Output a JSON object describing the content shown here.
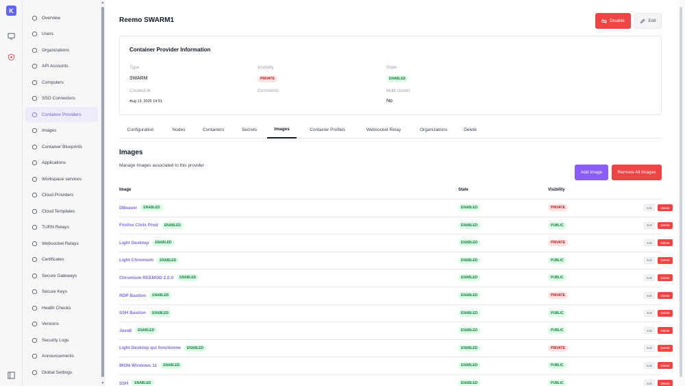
{
  "rail": {
    "logo": "K"
  },
  "sidebar": {
    "items": [
      {
        "label": "Overview",
        "icon": "home-icon"
      },
      {
        "label": "Users",
        "icon": "user-icon"
      },
      {
        "label": "Organizations",
        "icon": "building-icon"
      },
      {
        "label": "API Accounts",
        "icon": "api-icon"
      },
      {
        "label": "Computers",
        "icon": "computer-icon"
      },
      {
        "label": "SSO Connectors",
        "icon": "users-icon"
      },
      {
        "label": "Container Providers",
        "icon": "server-icon",
        "active": true
      },
      {
        "label": "Images",
        "icon": "layers-icon"
      },
      {
        "label": "Container Blueprints",
        "icon": "blueprint-icon"
      },
      {
        "label": "Applications",
        "icon": "puzzle-icon"
      },
      {
        "label": "Workspace services",
        "icon": "gear-icon"
      },
      {
        "label": "Cloud Providers",
        "icon": "cloud-icon"
      },
      {
        "label": "Cloud Templates",
        "icon": "template-icon"
      },
      {
        "label": "TURN Relays",
        "icon": "relay-icon"
      },
      {
        "label": "Websocket Relays",
        "icon": "code-icon"
      },
      {
        "label": "Certificates",
        "icon": "certificate-icon"
      },
      {
        "label": "Secure Gateways",
        "icon": "globe-icon"
      },
      {
        "label": "Secure Keys",
        "icon": "key-icon"
      },
      {
        "label": "Health Checks",
        "icon": "heart-icon"
      },
      {
        "label": "Versions",
        "icon": "info-icon"
      },
      {
        "label": "Security Logs",
        "icon": "shield-icon"
      },
      {
        "label": "Announcements",
        "icon": "bell-icon"
      },
      {
        "label": "Global Settings",
        "icon": "settings-icon"
      }
    ]
  },
  "header": {
    "title": "Reemo SWARM1",
    "disable_label": "Disable",
    "edit_label": "Edit"
  },
  "info": {
    "title": "Container Provider Information",
    "type_label": "Type",
    "type_value": "SWARM",
    "visibility_label": "Visibility",
    "visibility_value": "PRIVATE",
    "state_label": "State",
    "state_value": "ENABLED",
    "created_label": "Created At",
    "created_value": "Aug 13, 2025 14:51",
    "comments_label": "Comments",
    "multi_label": "Multi cluster",
    "multi_value": "No"
  },
  "tabs": [
    "Configuration",
    "Nodes",
    "Containers",
    "Secrets",
    "Images",
    "Container Profiles",
    "Websocket Relay",
    "Organizations",
    "Delete"
  ],
  "images_section": {
    "title": "Images",
    "description": "Manage Images associated to this provider",
    "add_label": "Add Image",
    "remove_label": "Remove All Images",
    "columns": [
      "Image",
      "State",
      "Visibility"
    ],
    "edit_label": "Edit",
    "delete_label": "Delete",
    "rows": [
      {
        "name": "DBeaver",
        "badge": "ENABLED",
        "state": "ENABLED",
        "visibility": "PRIVATE"
      },
      {
        "name": "Firefox Citrix Prod",
        "badge": "ENABLED",
        "state": "ENABLED",
        "visibility": "PUBLIC"
      },
      {
        "name": "Light Desktop",
        "badge": "ENABLED",
        "state": "ENABLED",
        "visibility": "PRIVATE"
      },
      {
        "name": "Light Chromium",
        "badge": "ENABLED",
        "state": "ENABLED",
        "visibility": "PUBLIC"
      },
      {
        "name": "Chromium REEMOD 2.0.0",
        "badge": "ENABLED",
        "state": "ENABLED",
        "visibility": "PUBLIC"
      },
      {
        "name": "RDP Bastion",
        "badge": "ENABLED",
        "state": "ENABLED",
        "visibility": "PRIVATE"
      },
      {
        "name": "SSH Bastion",
        "badge": "ENABLED",
        "state": "ENABLED",
        "visibility": "PUBLIC"
      },
      {
        "name": "Java8",
        "badge": "ENABLED",
        "state": "ENABLED",
        "visibility": "PUBLIC"
      },
      {
        "name": "Light Desktop qui fonctionne",
        "badge": "ENABLED",
        "state": "ENABLED",
        "visibility": "PRIVATE"
      },
      {
        "name": "IRON Windows 11",
        "badge": "ENABLED",
        "state": "ENABLED",
        "visibility": "PUBLIC"
      },
      {
        "name": "SSH",
        "badge": "ENABLED",
        "state": "ENABLED",
        "visibility": "PUBLIC"
      }
    ]
  },
  "colors": {
    "accent": "#6d5ce7",
    "danger": "#ef4444",
    "success": "#15803d"
  }
}
